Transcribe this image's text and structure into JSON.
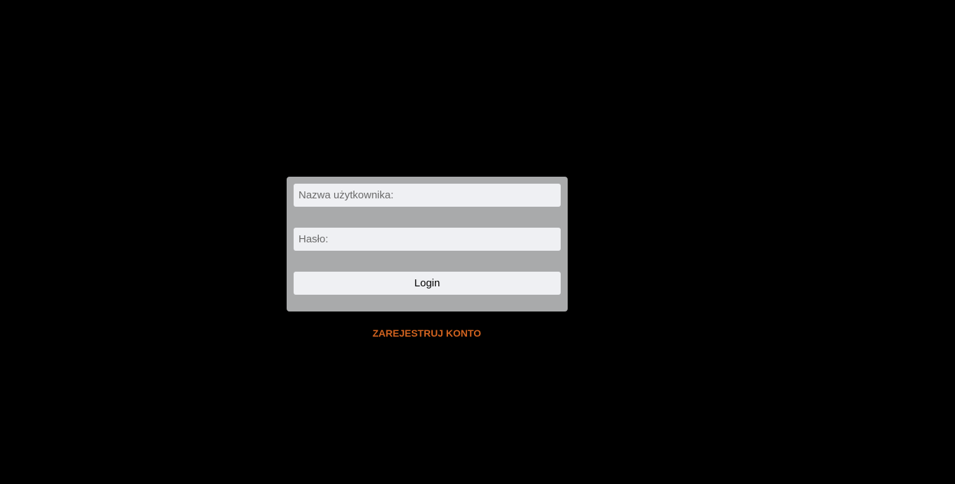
{
  "login_form": {
    "username_placeholder": "Nazwa użytkownika:",
    "password_placeholder": "Hasło:",
    "login_button_label": "Login"
  },
  "register_link": {
    "label": "ZAREJESTRUJ KONTO"
  },
  "colors": {
    "background": "#000000",
    "panel": "#a9aaab",
    "field": "#eff0f3",
    "link_accent": "#d0621f"
  }
}
